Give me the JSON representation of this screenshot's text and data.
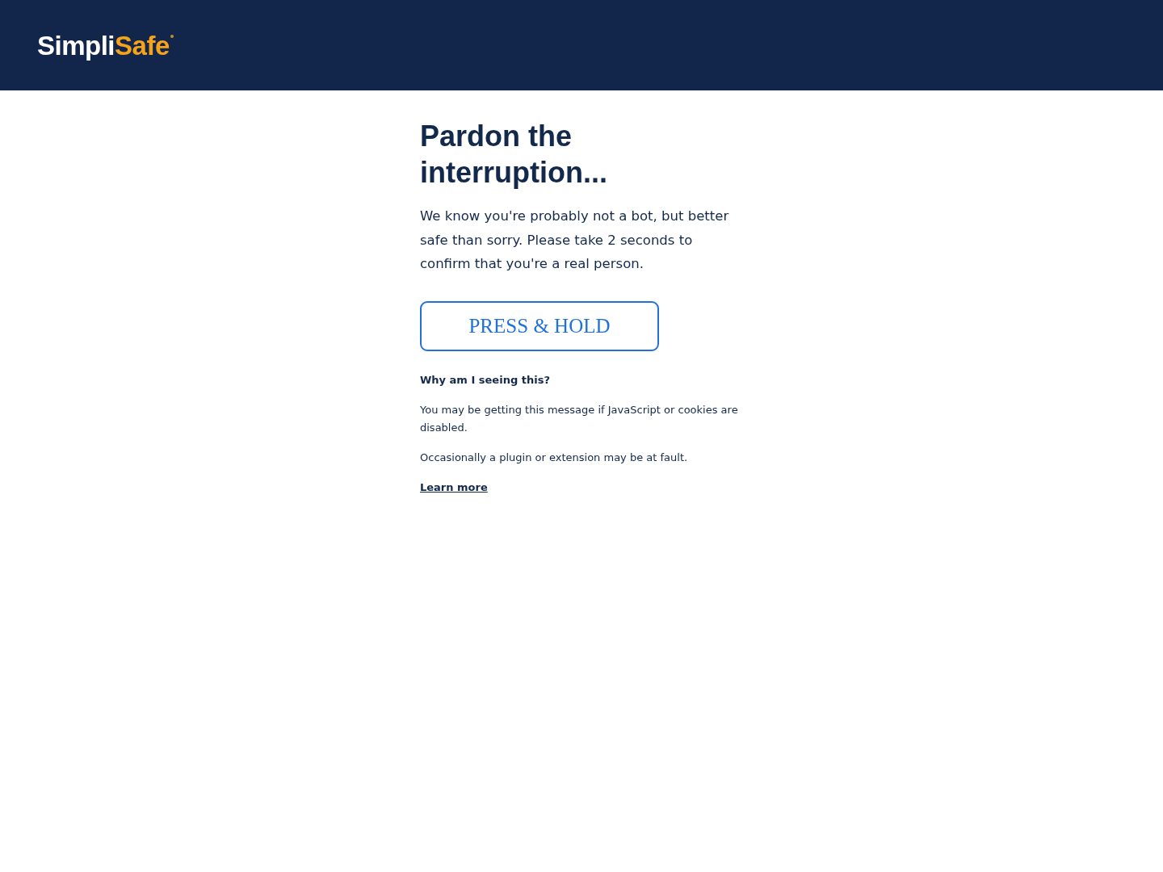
{
  "header": {
    "logo": {
      "text": "Simpli",
      "accent": "Safe"
    }
  },
  "main": {
    "title": "Pardon the interruption...",
    "intro": "We know you're probably not a bot, but better safe than sorry. Please take 2 seconds to confirm that you're a real person.",
    "hold_button": {
      "label": "PRESS & HOLD"
    },
    "why": {
      "heading": "Why am I seeing this?",
      "paragraphs": [
        "You may be getting this message if JavaScript or cookies are disabled.",
        "Occasionally a plugin or extension may be at fault."
      ],
      "link": "Learn more"
    }
  }
}
